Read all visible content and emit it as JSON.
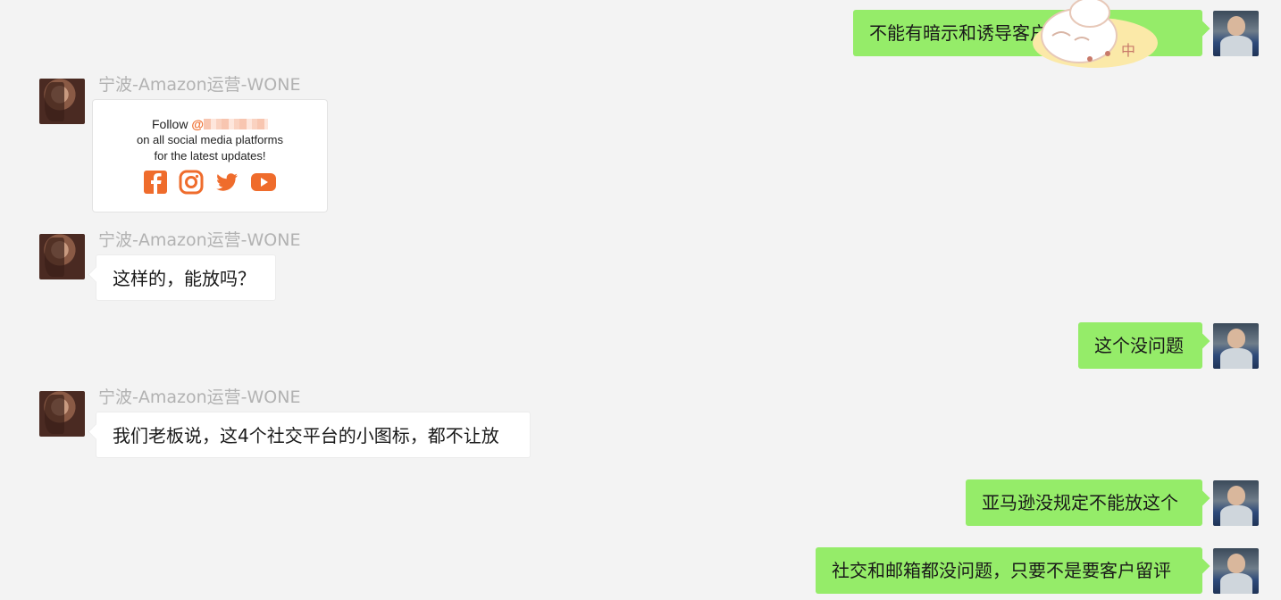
{
  "messages": [
    {
      "side": "right",
      "text": "不能有暗示和诱导客户留评的字眼"
    },
    {
      "side": "left",
      "sender": "宁波-Amazon运营-WONE",
      "type": "image",
      "card": {
        "follow": "Follow",
        "handle": "@",
        "line2": "on all social media platforms",
        "line3": "for the latest updates!",
        "icons": [
          "facebook-icon",
          "instagram-icon",
          "twitter-icon",
          "youtube-icon"
        ]
      }
    },
    {
      "side": "left",
      "sender": "宁波-Amazon运营-WONE",
      "text": "这样的，能放吗？"
    },
    {
      "side": "right",
      "text": "这个没问题"
    },
    {
      "side": "left",
      "sender": "宁波-Amazon运营-WONE",
      "text": "我们老板说，这4个社交平台的小图标，都不让放"
    },
    {
      "side": "right",
      "text": "亚马逊没规定不能放这个"
    },
    {
      "side": "right",
      "text": "社交和邮箱都没问题，只要不是要客户留评"
    }
  ],
  "sticker": {
    "label": "中"
  },
  "colors": {
    "background": "#f3f3f3",
    "bubble_green": "#95ec69",
    "bubble_white": "#ffffff",
    "brand_orange": "#ef6c2c",
    "name_gray": "#b2b2b2"
  }
}
